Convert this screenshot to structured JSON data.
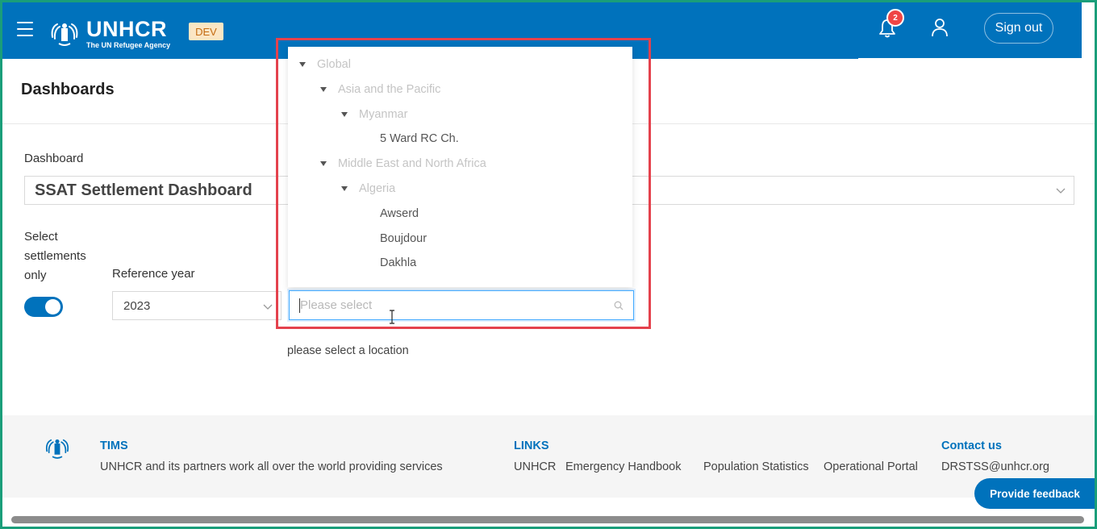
{
  "header": {
    "logo_name": "UNHCR",
    "logo_sub": "The UN Refugee Agency",
    "env_badge": "DEV",
    "notification_count": "2",
    "signout_label": "Sign out"
  },
  "page": {
    "title": "Dashboards",
    "dashboard_label": "Dashboard",
    "dashboard_value": "SSAT Settlement Dashboard",
    "select_settlements_label": "Select settlements only",
    "select_settlements_on": true,
    "reference_year_label": "Reference year",
    "reference_year_value": "2023"
  },
  "location_dropdown": {
    "tree": [
      {
        "label": "Global",
        "level": 0,
        "expanded": true,
        "selectable": false
      },
      {
        "label": "Asia and the Pacific",
        "level": 1,
        "expanded": true,
        "selectable": false
      },
      {
        "label": "Myanmar",
        "level": 2,
        "expanded": true,
        "selectable": false
      },
      {
        "label": "5 Ward RC Ch.",
        "level": 3,
        "expanded": false,
        "selectable": true
      },
      {
        "label": "Middle East and North Africa",
        "level": 1,
        "expanded": true,
        "selectable": false
      },
      {
        "label": "Algeria",
        "level": 2,
        "expanded": true,
        "selectable": false
      },
      {
        "label": "Awserd",
        "level": 3,
        "expanded": false,
        "selectable": true
      },
      {
        "label": "Boujdour",
        "level": 3,
        "expanded": false,
        "selectable": true
      },
      {
        "label": "Dakhla",
        "level": 3,
        "expanded": false,
        "selectable": true
      }
    ],
    "placeholder": "Please select",
    "hint": "please select a location"
  },
  "footer": {
    "tims_heading": "TIMS",
    "tims_text": "UNHCR and its partners work all over the world providing services",
    "links_heading": "LINKS",
    "links": [
      "UNHCR",
      "Emergency Handbook",
      "Population Statistics",
      "Operational Portal"
    ],
    "contact_heading": "Contact us",
    "contact_email": "DRSTSS@unhcr.org"
  },
  "feedback_label": "Provide feedback",
  "colors": {
    "brand": "#0072bc",
    "badge": "#ef4545",
    "highlight": "#e4424d",
    "dev_badge_bg": "#fbe6c4"
  }
}
